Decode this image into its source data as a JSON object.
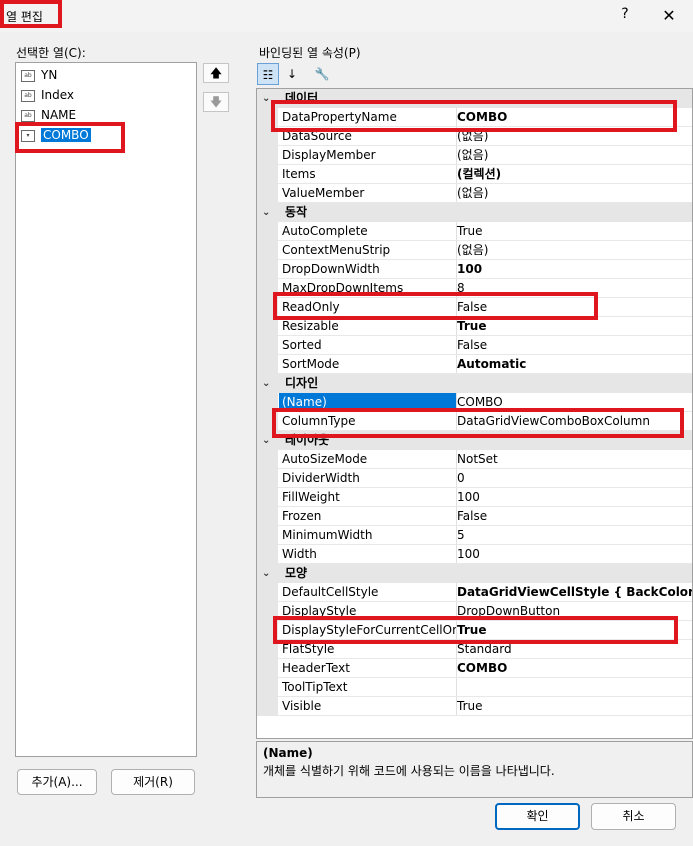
{
  "window": {
    "title": "열 편집",
    "help_label": "?",
    "close_label": "✕"
  },
  "left_panel": {
    "label": "선택한 열(C):",
    "columns": [
      {
        "name": "YN",
        "icon": "text-column-icon"
      },
      {
        "name": "Index",
        "icon": "text-column-icon"
      },
      {
        "name": "NAME",
        "icon": "text-column-icon"
      },
      {
        "name": "COMBO",
        "icon": "combobox-column-icon",
        "selected": true
      }
    ],
    "move_up_label": "🡅",
    "move_down_label": "🡇",
    "add_label": "추가(A)...",
    "remove_label": "제거(R)"
  },
  "right_panel": {
    "label": "바인딩된 열 속성(P)",
    "toolbar": {
      "categorized_icon": "categorized-icon",
      "alphabetical_icon": "alphabetical-icon",
      "property_pages_icon": "wrench-icon"
    },
    "categories": [
      {
        "name": "데이터",
        "chevron": "⌄",
        "rows": [
          {
            "name": "DataPropertyName",
            "value": "COMBO",
            "bold": true
          },
          {
            "name": "DataSource",
            "value": "(없음)"
          },
          {
            "name": "DisplayMember",
            "value": "(없음)"
          },
          {
            "name": "Items",
            "value": "(컬렉션)",
            "bold": true
          },
          {
            "name": "ValueMember",
            "value": "(없음)"
          }
        ]
      },
      {
        "name": "동작",
        "chevron": "⌄",
        "rows": [
          {
            "name": "AutoComplete",
            "value": "True"
          },
          {
            "name": "ContextMenuStrip",
            "value": "(없음)"
          },
          {
            "name": "DropDownWidth",
            "value": "100",
            "bold": true
          },
          {
            "name": "MaxDropDownItems",
            "value": "8"
          },
          {
            "name": "ReadOnly",
            "value": "False"
          },
          {
            "name": "Resizable",
            "value": "True",
            "bold": true
          },
          {
            "name": "Sorted",
            "value": "False"
          },
          {
            "name": "SortMode",
            "value": "Automatic",
            "bold": true
          }
        ]
      },
      {
        "name": "디자인",
        "chevron": "⌄",
        "rows": [
          {
            "name": "(Name)",
            "value": "COMBO",
            "selected": true
          },
          {
            "name": "ColumnType",
            "value": "DataGridViewComboBoxColumn"
          }
        ]
      },
      {
        "name": "레이아웃",
        "chevron": "⌄",
        "rows": [
          {
            "name": "AutoSizeMode",
            "value": "NotSet"
          },
          {
            "name": "DividerWidth",
            "value": "0"
          },
          {
            "name": "FillWeight",
            "value": "100"
          },
          {
            "name": "Frozen",
            "value": "False"
          },
          {
            "name": "MinimumWidth",
            "value": "5"
          },
          {
            "name": "Width",
            "value": "100"
          }
        ]
      },
      {
        "name": "모양",
        "chevron": "⌄",
        "rows": [
          {
            "name": "DefaultCellStyle",
            "value": "DataGridViewCellStyle { BackColor=Co",
            "bold": true
          },
          {
            "name": "DisplayStyle",
            "value": "DropDownButton"
          },
          {
            "name": "DisplayStyleForCurrentCellOnly",
            "value": "True",
            "bold": true
          },
          {
            "name": "FlatStyle",
            "value": "Standard"
          },
          {
            "name": "HeaderText",
            "value": "COMBO",
            "bold": true
          },
          {
            "name": "ToolTipText",
            "value": ""
          },
          {
            "name": "Visible",
            "value": "True"
          }
        ]
      }
    ],
    "description": {
      "title": "(Name)",
      "text": "개체를 식별하기 위해 코드에 사용되는 이름을 나타냅니다."
    }
  },
  "footer": {
    "ok_label": "확인",
    "cancel_label": "취소"
  },
  "colors": {
    "highlight_red": "#e0161e",
    "selection_blue": "#0078d7"
  }
}
